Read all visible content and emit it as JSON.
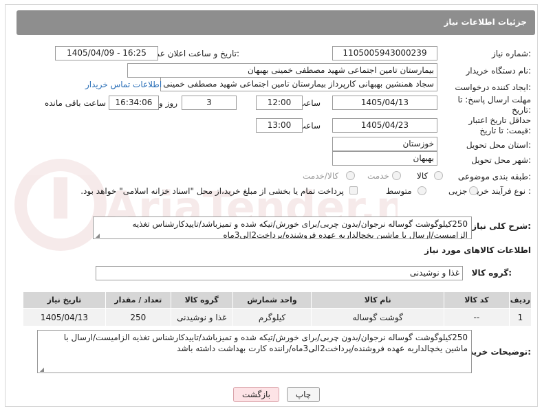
{
  "header": {
    "title": "جزئیات اطلاعات نیاز"
  },
  "fields": {
    "need_number_label": "شماره نیاز:",
    "need_number": "1105005943000239",
    "announce_label": "تاریخ و ساعت اعلان عمومی:",
    "announce_value": "1405/04/09 - 16:25",
    "buyer_org_label": "نام دستگاه خریدار:",
    "buyer_org": "بیمارستان تامین اجتماعی شهید مصطفی خمینی بهبهان",
    "requester_label": "ایجاد کننده درخواست:",
    "requester": "سجاد همنشین بهبهانی کارپرداز بیمارستان تامین اجتماعی شهید مصطفی خمینی",
    "buyer_contact_link": "اطلاعات تماس خریدار",
    "reply_deadline_label": "مهلت ارسال پاسخ: تا تاریخ:",
    "reply_date": "1405/04/13",
    "time_label": "ساعت",
    "reply_time": "12:00",
    "days_value": "3",
    "days_label": "روز و",
    "remaining_time": "16:34:06",
    "remaining_label": "ساعت باقی مانده",
    "price_validity_label": "حداقل تاریخ اعتبار قیمت: تا تاریخ:",
    "price_date": "1405/04/23",
    "price_time": "13:00",
    "delivery_province_label": "استان محل تحویل:",
    "delivery_province": "خوزستان",
    "delivery_city_label": "شهر محل تحویل:",
    "delivery_city": "بهبهان",
    "category_label": "طبقه بندی موضوعی:",
    "category_options": [
      "کالا",
      "خدمت",
      "کالا/خدمت"
    ],
    "process_label": "نوع فرآیند خرید :",
    "process_options": [
      "جزیی",
      "متوسط"
    ],
    "payment_note": "پرداخت تمام یا بخشی از مبلغ خرید،از محل \"اسناد خزانه اسلامی\" خواهد بود."
  },
  "general_description": {
    "label": "شرح کلی نیاز:",
    "line1": "250کیلوگوشت گوساله نرجوان/بدون چربی/برای خورش/تیکه شده و تمیزباشد/تاییدکارشناس تغذیه",
    "line2": "الزامیست/ارسال با ماشین یخچالداربه عهده فروشنده/پرداخت2الی3ماه"
  },
  "goods_info": {
    "title": "اطلاعات کالاهای مورد نیاز",
    "group_label": "گروه کالا:",
    "group_value": "غذا و نوشیدنی"
  },
  "table": {
    "headers": [
      "ردیف",
      "کد کالا",
      "نام کالا",
      "واحد شمارش",
      "گروه کالا",
      "تعداد / مقدار",
      "تاریخ نیاز"
    ],
    "rows": [
      [
        "1",
        "--",
        "گوشت گوساله",
        "کیلوگرم",
        "غذا و نوشیدنی",
        "250",
        "1405/04/13"
      ]
    ]
  },
  "buyer_notes": {
    "label": "توضیحات خریدار:",
    "line1": "250کیلوگوشت گوساله نرجوان/بدون چربی/برای خورش/تیکه شده و تمیزباشد/تاییدکارشناس تغذیه الزامیست/ارسال با",
    "line2": "ماشین یخچالداربه عهده فروشنده/پرداخت2الی3ماه/راننده کارت بهداشت داشته باشد"
  },
  "buttons": {
    "print": "چاپ",
    "back": "بازگشت"
  },
  "watermark": {
    "text": "AriaTender.net"
  },
  "colors": {
    "header_bg": "#8e8e8e",
    "link": "#2a6fb8",
    "back_button": "#fde3e6",
    "table_header": "#d6d6d6"
  }
}
